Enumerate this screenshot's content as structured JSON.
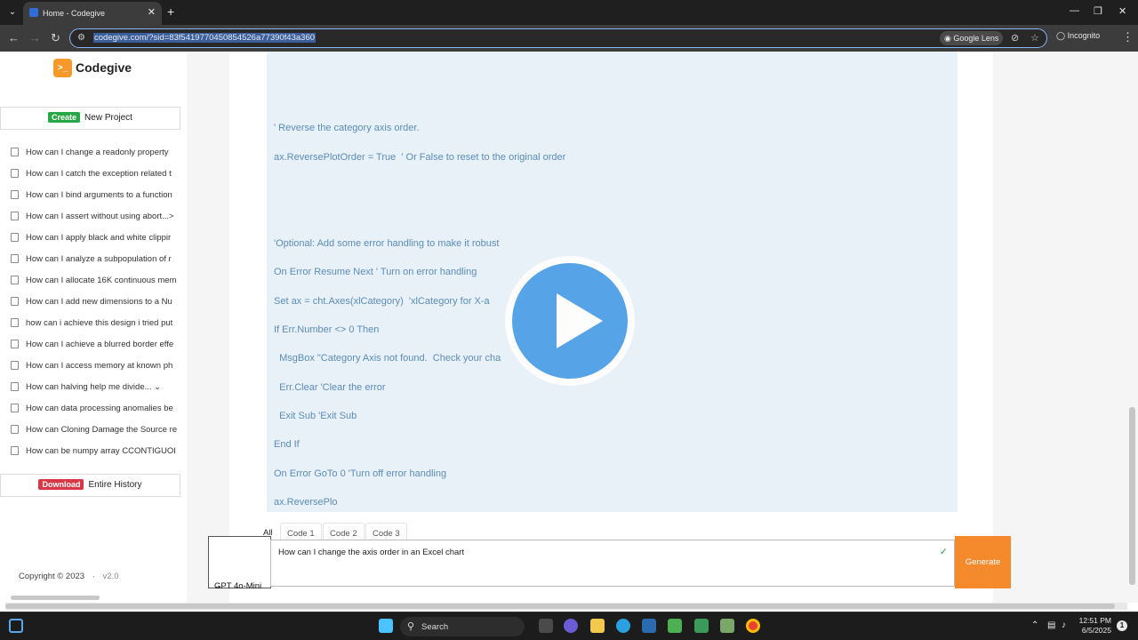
{
  "browser": {
    "tab_title": "Home - Codegive",
    "url": "codegive.com/?sid=83f5419770450854526a77390f43a360",
    "lens_label": "Google Lens",
    "incognito_label": "Incognito"
  },
  "sidebar": {
    "logo_mark": ">_",
    "brand": "Codegive",
    "create_badge": "Create",
    "create_label": "New Project",
    "history": [
      "How can I change a readonly property",
      "How can I catch the exception related t",
      "How can I bind arguments to a function",
      "How can I assert without using abort...>",
      "How can I apply black and white clippir",
      "How can I analyze a subpopulation of r",
      "How can I allocate 16K continuous mem",
      "How can I add new dimensions to a Nu",
      "how can i achieve this design i tried put",
      "How can I achieve a blurred border effe",
      "How can I access memory at known ph",
      "How can halving help me divide...    ⌄",
      "How can data processing anomalies be",
      "How can Cloning Damage the Source re",
      "How can be numpy array CCONTIGUOI"
    ],
    "download_badge": "Download",
    "download_label": "Entire History",
    "copyright": "Copyright © 2023",
    "separator": "·",
    "version": "v2.0"
  },
  "code": {
    "lines": [
      "' Reverse the category axis order.",
      "ax.ReversePlotOrder = True  ' Or False to reset to the original order",
      "'Optional: Add some error handling to make it robust",
      "On Error Resume Next ' Turn on error handling",
      "Set ax = cht.Axes(xlCategory)  'xlCategory for X-a",
      "If Err.Number <> 0 Then",
      "  MsgBox \"Category Axis not found.  Check your cha",
      "  Err.Clear 'Clear the error",
      "  Exit Sub 'Exit Sub",
      "End If",
      "On Error GoTo 0 'Turn off error handling",
      "ax.ReversePlo"
    ]
  },
  "tabs": [
    "All",
    "Code 1",
    "Code 2",
    "Code 3"
  ],
  "composer": {
    "model": "GPT 4o-Mini",
    "prompt_value": "How can I change the axis order in an Excel chart",
    "generate_label": "Generate"
  },
  "taskbar": {
    "search_label": "Search",
    "time": "12:51 PM",
    "date": "6/5/2025",
    "notifications": "1"
  },
  "colors": {
    "accent_orange": "#f58a2d",
    "create_green": "#28a745",
    "download_red": "#dc3545",
    "code_text": "#5b8db8",
    "code_bg": "#e8f0f8",
    "play_blue": "#4a9ee6"
  }
}
